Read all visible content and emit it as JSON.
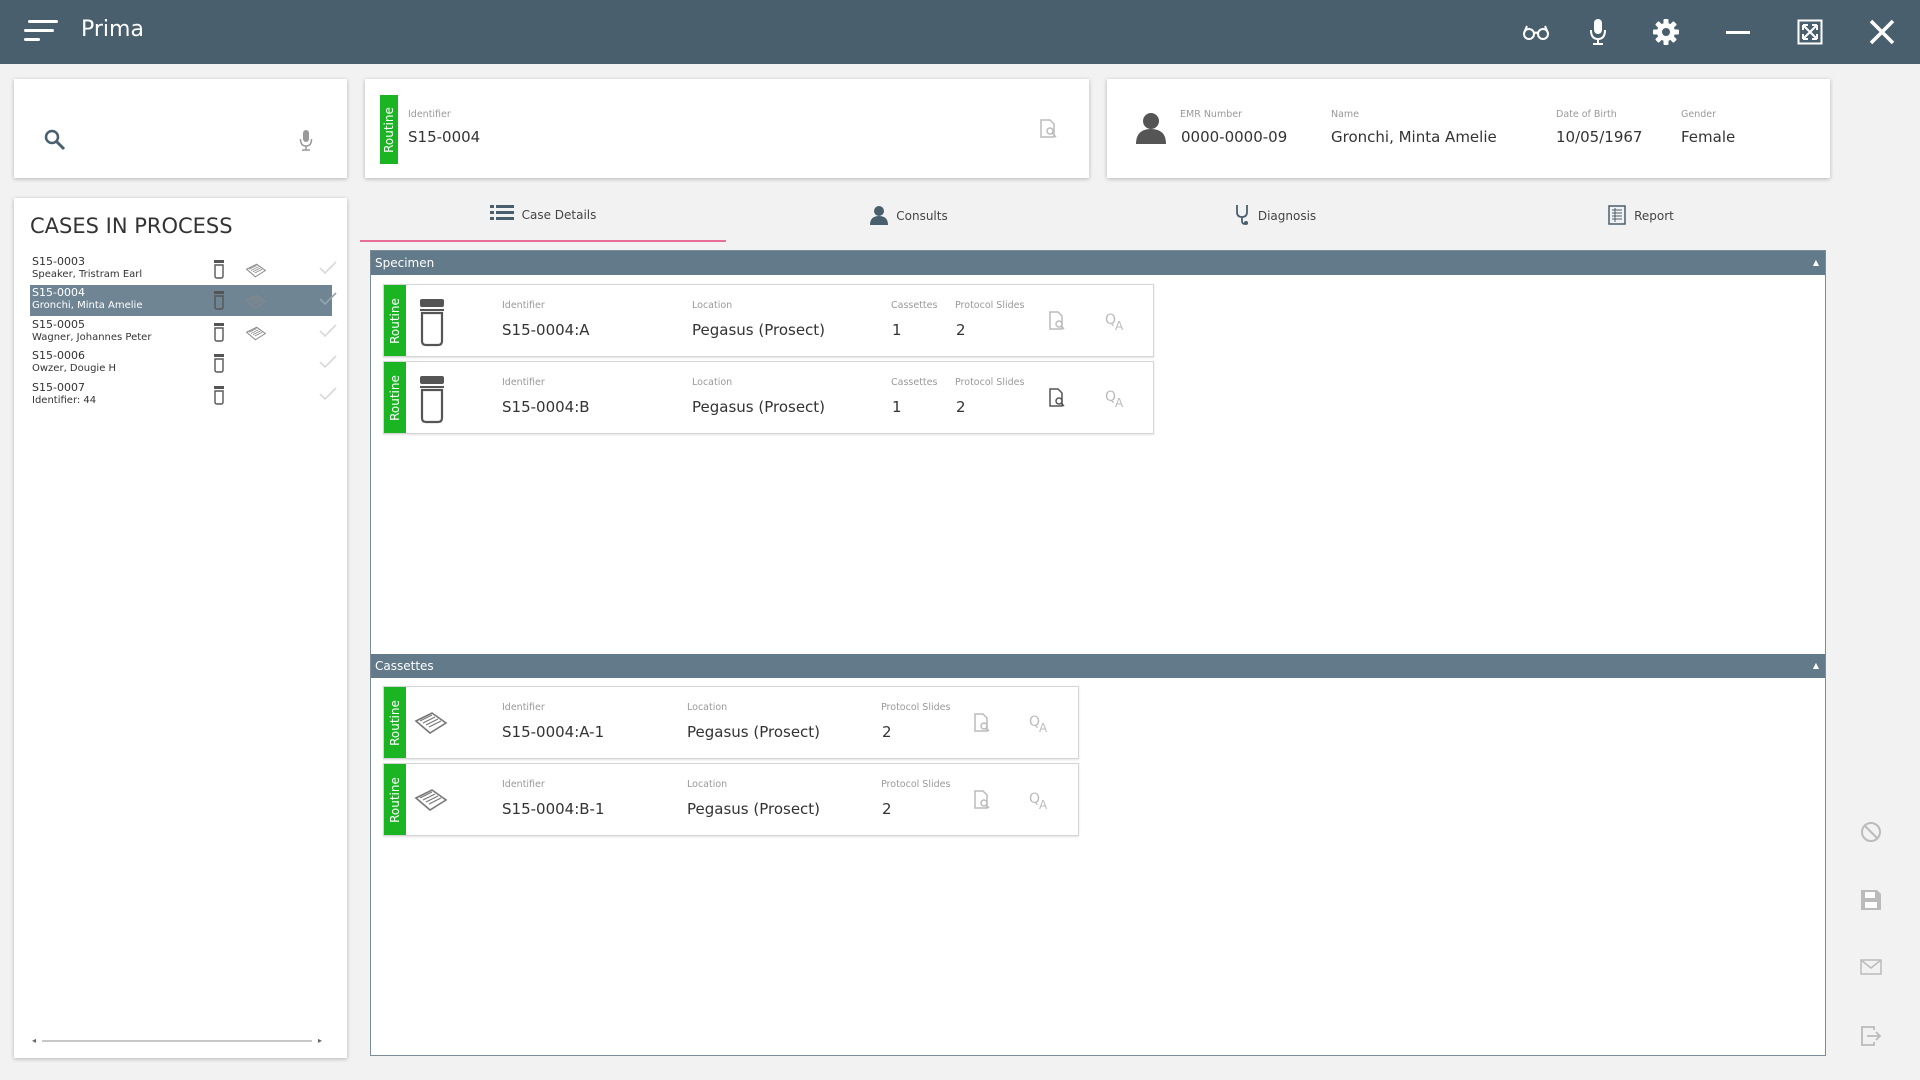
{
  "app": {
    "title": "Prima"
  },
  "titlebar_icons": [
    "reading-glasses-icon",
    "microphone-icon",
    "gear-icon",
    "minimize-icon",
    "fullscreen-icon",
    "close-icon"
  ],
  "search": {
    "placeholder": ""
  },
  "cases_panel": {
    "title": "CASES IN PROCESS",
    "cases": [
      {
        "id": "S15-0003",
        "name": "Speaker, Tristram Earl",
        "has_cassette": true,
        "selected": false
      },
      {
        "id": "S15-0004",
        "name": "Gronchi, Minta Amelie",
        "has_cassette": true,
        "selected": true
      },
      {
        "id": "S15-0005",
        "name": "Wagner, Johannes Peter",
        "has_cassette": true,
        "selected": false
      },
      {
        "id": "S15-0006",
        "name": "Owzer, Dougie H",
        "has_cassette": false,
        "selected": false
      },
      {
        "id": "S15-0007",
        "name": "Identifier: 44",
        "has_cassette": false,
        "selected": false
      }
    ]
  },
  "case_header": {
    "priority": "Routine",
    "identifier_label": "Identifier",
    "identifier": "S15-0004"
  },
  "patient": {
    "emr_label": "EMR Number",
    "emr": "0000-0000-09",
    "name_label": "Name",
    "name": "Gronchi, Minta Amelie",
    "dob_label": "Date of Birth",
    "dob": "10/05/1967",
    "gender_label": "Gender",
    "gender": "Female"
  },
  "tabs": [
    {
      "label": "Case Details",
      "icon": "list-icon",
      "active": true
    },
    {
      "label": "Consults",
      "icon": "person-icon",
      "active": false
    },
    {
      "label": "Diagnosis",
      "icon": "stethoscope-icon",
      "active": false
    },
    {
      "label": "Report",
      "icon": "report-icon",
      "active": false
    }
  ],
  "specimen_section": {
    "title": "Specimen",
    "labels": {
      "identifier": "Identifier",
      "location": "Location",
      "cassettes": "Cassettes",
      "slides": "Protocol Slides"
    },
    "items": [
      {
        "priority": "Routine",
        "identifier": "S15-0004:A",
        "location": "Pegasus (Prosect)",
        "cassettes": "1",
        "slides": "2"
      },
      {
        "priority": "Routine",
        "identifier": "S15-0004:B",
        "location": "Pegasus (Prosect)",
        "cassettes": "1",
        "slides": "2"
      }
    ]
  },
  "cassettes_section": {
    "title": "Cassettes",
    "labels": {
      "identifier": "Identifier",
      "location": "Location",
      "slides": "Protocol Slides"
    },
    "items": [
      {
        "priority": "Routine",
        "identifier": "S15-0004:A-1",
        "location": "Pegasus (Prosect)",
        "slides": "2"
      },
      {
        "priority": "Routine",
        "identifier": "S15-0004:B-1",
        "location": "Pegasus (Prosect)",
        "slides": "2"
      }
    ]
  },
  "side_actions": [
    "cancel-icon",
    "save-icon",
    "mail-icon",
    "exit-icon"
  ],
  "colors": {
    "titlebar": "#4a5f6e",
    "section_header": "#627a89",
    "routine": "#1bb524",
    "selected_row": "#6f8594",
    "active_tab_underline": "#e56f98"
  }
}
